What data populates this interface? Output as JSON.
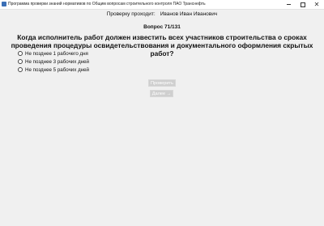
{
  "window": {
    "title": "Программа проверки знаний нормативов по Общим вопросам строительного контроля ПАО Транснефть",
    "controls": {
      "minimize": "—",
      "maximize": "□",
      "close": "✕"
    }
  },
  "tester": {
    "label": "Проверку проходит:",
    "name": "Иванов Иван Иванович"
  },
  "question": {
    "counter": "Вопрос 71/131",
    "text": "Когда исполнитель работ должен известить всех участников строительства о сроках проведения процедуры освидетельствования и документального оформления скрытых работ?"
  },
  "options": [
    {
      "label": "Не позднее 1 рабочего дня",
      "selected": false
    },
    {
      "label": "Не позднее 3 рабочих дней",
      "selected": false
    },
    {
      "label": "Не позднее 5 рабочих дней",
      "selected": false
    }
  ],
  "buttons": {
    "check": "Проверить",
    "next": "Далее →"
  }
}
